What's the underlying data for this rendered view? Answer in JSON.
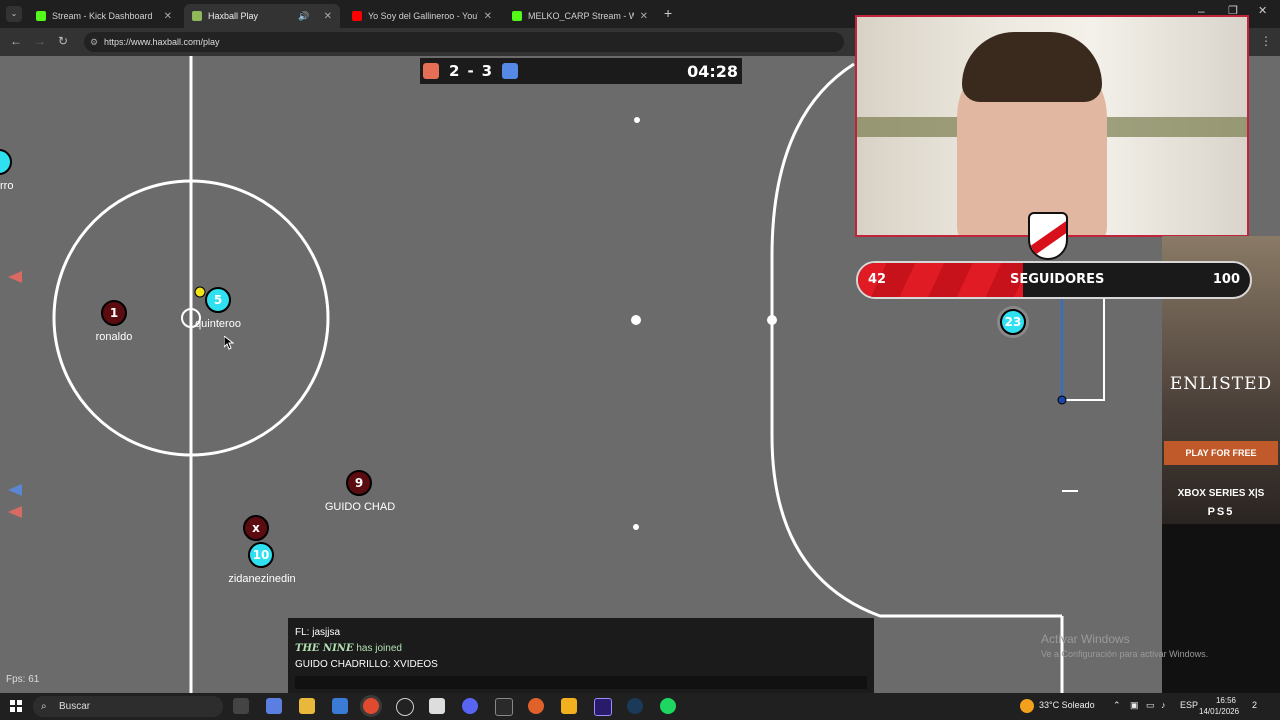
{
  "browser": {
    "tabs": [
      {
        "label": "Stream - Kick Dashboard",
        "color": "#53fc18"
      },
      {
        "label": "Haxball Play",
        "color": "#8fb85a"
      },
      {
        "label": "Yo Soy del Gallineroo - YouTub",
        "color": "#ff0000"
      },
      {
        "label": "MELKO_CARP Stream - Watch L",
        "color": "#53fc18"
      }
    ],
    "new_tab": "+",
    "url": "https://www.haxball.com/play"
  },
  "score": {
    "red": "2",
    "separator": "-",
    "blue": "3",
    "time": "04:28",
    "red_color": "#e56e56",
    "blue_color": "#5689e5"
  },
  "players": [
    {
      "number": "1",
      "name": "ronaldo",
      "team": "red"
    },
    {
      "number": "5",
      "name": "quinteroo",
      "team": "blue"
    },
    {
      "number": "9",
      "name": "GUIDO CHAD",
      "team": "red"
    },
    {
      "number": "x",
      "name": "",
      "team": "red"
    },
    {
      "number": "10",
      "name": "zidanezinedin",
      "team": "blue"
    },
    {
      "number": "23",
      "name": "",
      "team": "blue"
    },
    {
      "number": "",
      "name": "rro",
      "team": "blue"
    }
  ],
  "chat": {
    "lines": [
      {
        "text": "FL: jasjjsa"
      },
      {
        "name": "THE NINE",
        "text": "has joined"
      },
      {
        "text": "GUIDO CHADRILLO: XVIDEOS"
      }
    ]
  },
  "fps": "Fps: 61",
  "overlay": {
    "followers_current": "42",
    "followers_label": "SEGUIDORES",
    "followers_goal": "100",
    "progress": 0.42
  },
  "ad": {
    "title": "ENLISTED",
    "cta": "PLAY FOR FREE",
    "platform1": "XBOX SERIES X|S",
    "platform2": "PS5"
  },
  "watermark": {
    "title": "Activar Windows",
    "subtitle": "Ve a Configuración para activar Windows."
  },
  "taskbar": {
    "search_placeholder": "Buscar",
    "weather": "33°C  Soleado",
    "lang": "ESP",
    "time": "16:56",
    "date": "14/01/2026",
    "notifications": "2"
  }
}
